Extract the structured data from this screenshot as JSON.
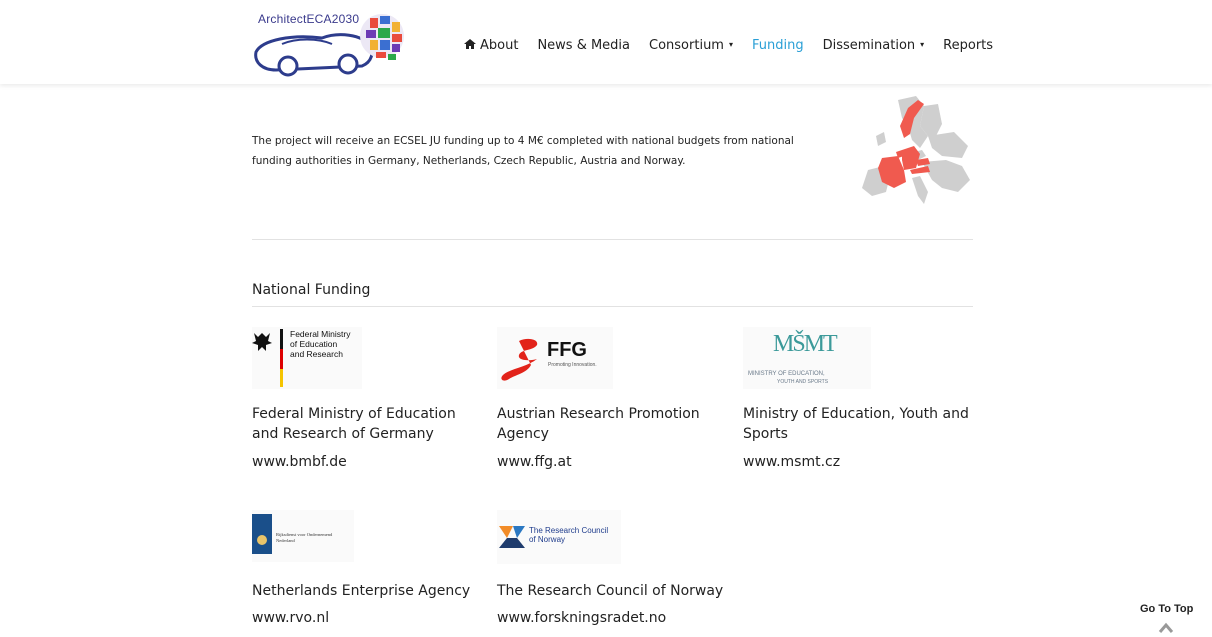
{
  "header": {
    "logo_text": "ArchitectECA2030",
    "nav": [
      {
        "label": "About",
        "icon": "home-icon",
        "has_dropdown": false,
        "active": false
      },
      {
        "label": "News & Media",
        "has_dropdown": false,
        "active": false
      },
      {
        "label": "Consortium",
        "has_dropdown": true,
        "active": false
      },
      {
        "label": "Funding",
        "has_dropdown": false,
        "active": true
      },
      {
        "label": "Dissemination",
        "has_dropdown": true,
        "active": false
      },
      {
        "label": "Reports",
        "has_dropdown": false,
        "active": false
      }
    ],
    "active_color": "#2a9fd6"
  },
  "intro": {
    "text": "The project will receive an ECSEL JU funding up to 4 M€ completed with national budgets from national funding authorities in Germany, Netherlands, Czech Republic, Austria and Norway."
  },
  "map": {
    "highlight_color": "#f05a4f",
    "base_color": "#cfcfcf"
  },
  "funding": {
    "title": "National Funding",
    "agencies": [
      {
        "name": "Federal Ministry of Education and Research of Germany",
        "url": "www.bmbf.de",
        "logo_text": [
          "Federal Ministry",
          "of Education",
          "and Research"
        ]
      },
      {
        "name": "Austrian Research Promotion Agency",
        "url": "www.ffg.at",
        "logo_text": [
          "FFG",
          "Promoting Innovation."
        ]
      },
      {
        "name": "Ministry of Education, Youth and Sports",
        "url": "www.msmt.cz",
        "logo_text": [
          "MŠMT",
          "MINISTRY OF EDUCATION,",
          "YOUTH AND SPORTS"
        ]
      },
      {
        "name": "Netherlands Enterprise Agency",
        "url": "www.rvo.nl",
        "logo_text": [
          "Rijksdienst voor Ondernemend",
          "Nederland"
        ]
      },
      {
        "name": "The Research Council of Norway",
        "url": "www.forskningsradet.no",
        "logo_text": [
          "The Research Council",
          "of Norway"
        ]
      }
    ]
  },
  "footer": {
    "go_to_top": "Go To Top"
  }
}
